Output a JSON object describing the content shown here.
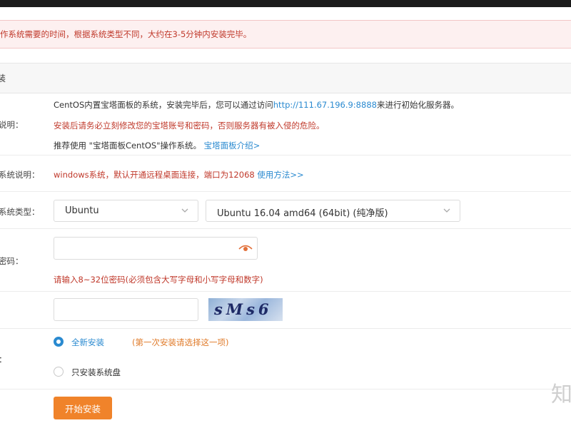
{
  "alert": {
    "text": "作系统需要的时间，根据系统类型不同，大约在3-5分钟内安装完毕。"
  },
  "panel": {
    "title": "装"
  },
  "system_info": {
    "label": "说明：",
    "line1_prefix": "CentOS内置宝塔面板的系统，安装完毕后，您可以通过访问",
    "line1_link": "http://111.67.196.9:8888",
    "line1_suffix": "来进行初始化服务器。",
    "line2": "安装后请务必立刻修改您的宝塔账号和密码，否则服务器有被入侵的危险。",
    "line3_prefix": "推荐使用 \"宝塔面板CentOS\"操作系统。",
    "line3_link": "宝塔面板介绍>"
  },
  "windows_info": {
    "label": "系统说明：",
    "text": "windows系统，默认开通远程桌面连接，端口为12068",
    "link": "使用方法>>"
  },
  "os_type": {
    "label": "系统类型：",
    "family": "Ubuntu",
    "version": "Ubuntu 16.04  amd64 (64bit)  (纯净版)"
  },
  "password": {
    "label": "密码：",
    "value": "",
    "hint": "请输入8~32位密码(必须包含大写字母和小写字母和数字)"
  },
  "captcha": {
    "value": "",
    "code": "sMs6"
  },
  "install_mode": {
    "label": "：",
    "option_full": "全新安装",
    "option_full_note": "(第一次安装请选择这一项)",
    "option_sys": "只安装系统盘"
  },
  "submit": {
    "label": "开始安装"
  },
  "watermark": {
    "text": "知"
  },
  "colors": {
    "accent": "#2a8ad0",
    "primary_button": "#f0832a",
    "warning": "#c0392b"
  }
}
